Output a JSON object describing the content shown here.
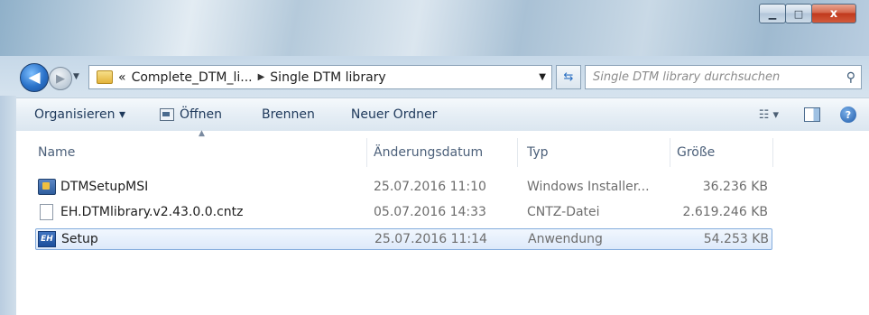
{
  "window": {
    "controls": {
      "minimize": "▁",
      "maximize": "□",
      "close": "x"
    }
  },
  "address": {
    "overflow": "«",
    "crumbs": [
      "Complete_DTM_li...",
      "Single DTM library"
    ],
    "search_placeholder": "Single DTM library durchsuchen"
  },
  "toolbar": {
    "organize": "Organisieren ▾",
    "open": "Öffnen",
    "burn": "Brennen",
    "new_folder": "Neuer Ordner",
    "views": "☷ ▾",
    "help": "?"
  },
  "columns": {
    "name": "Name",
    "date": "Änderungsdatum",
    "type": "Typ",
    "size": "Größe"
  },
  "files": [
    {
      "name": "DTMSetupMSI",
      "date": "25.07.2016 11:10",
      "type": "Windows Installer...",
      "size": "36.236 KB",
      "icon": "msi-icon"
    },
    {
      "name": "EH.DTMlibrary.v2.43.0.0.cntz",
      "date": "05.07.2016 14:33",
      "type": "CNTZ-Datei",
      "size": "2.619.246 KB",
      "icon": "file-icon"
    },
    {
      "name": "Setup",
      "date": "25.07.2016 11:14",
      "type": "Anwendung",
      "size": "54.253 KB",
      "icon": "exe-icon",
      "exe_label": "EH"
    }
  ]
}
